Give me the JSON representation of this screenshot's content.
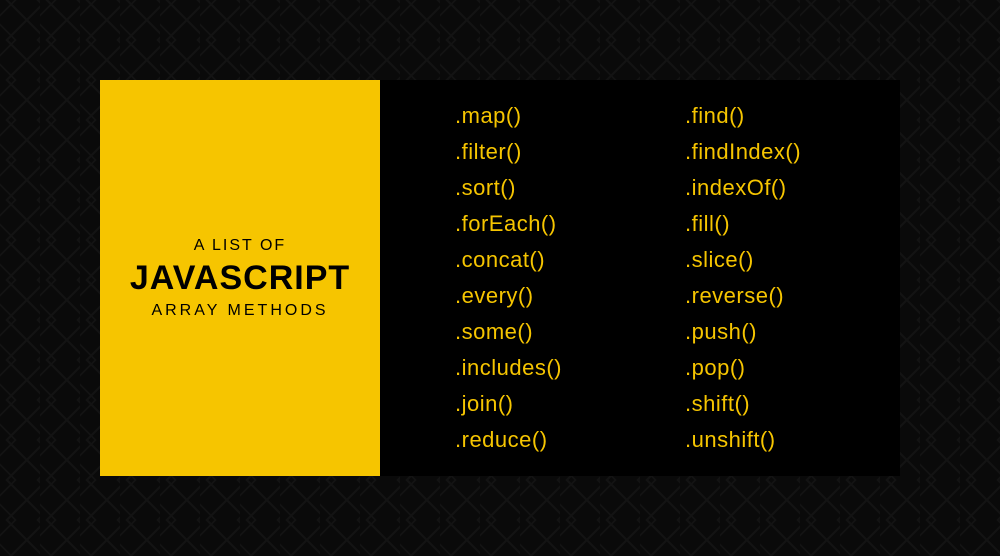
{
  "title": {
    "pre": "A LIST OF",
    "main": "JAVASCRIPT",
    "sub": "ARRAY METHODS"
  },
  "methods": {
    "col1": [
      ".map()",
      ".filter()",
      ".sort()",
      ".forEach()",
      ".concat()",
      ".every()",
      ".some()",
      ".includes()",
      ".join()",
      ".reduce()"
    ],
    "col2": [
      ".find()",
      ".findIndex()",
      ".indexOf()",
      ".fill()",
      ".slice()",
      ".reverse()",
      ".push()",
      ".pop()",
      ".shift()",
      ".unshift()"
    ]
  }
}
